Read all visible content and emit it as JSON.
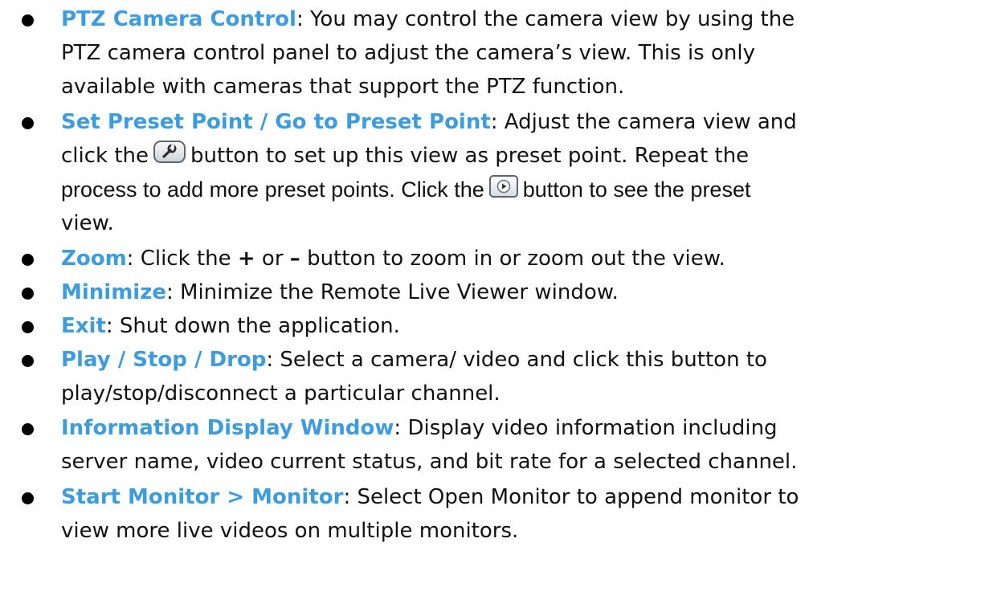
{
  "items": [
    {
      "term": "PTZ Camera Control",
      "lines": [
        ": You may control the camera view by using the",
        "PTZ camera control panel to adjust the camera’s view. This is only",
        "available with cameras that support the PTZ function."
      ]
    },
    {
      "term": "Set Preset Point / Go to Preset Point",
      "line1": ": Adjust the camera view and",
      "line2_a": "click the",
      "line2_b": "button to set up this view as preset point. Repeat the",
      "line3_a": "process to add more preset points. Click the",
      "line3_b": "button to see the preset",
      "line4": "view.",
      "icons": [
        "wrench-icon",
        "play-icon"
      ]
    },
    {
      "term": "Zoom",
      "text_a": ": Click the",
      "plus": "+",
      "text_b": "or",
      "minus": "–",
      "text_c": "button to zoom in or zoom out the view."
    },
    {
      "term": "Minimize",
      "text": ": Minimize the Remote Live Viewer window."
    },
    {
      "term": "Exit",
      "text": ": Shut down the application."
    },
    {
      "term": "Play / Stop / Drop",
      "lines": [
        ": Select a camera/ video and click this button to",
        "play/stop/disconnect a particular channel."
      ]
    },
    {
      "term": "Information Display Window",
      "lines": [
        ": Display video information including",
        "server name, video current status, and bit rate for a selected channel."
      ]
    },
    {
      "term": "Start Monitor > Monitor",
      "lines": [
        ": Select Open Monitor to append monitor to",
        "view more live videos on multiple monitors."
      ]
    }
  ],
  "colors": {
    "term": "#3d9ce0",
    "text": "#111111",
    "bullet": "#000000"
  }
}
